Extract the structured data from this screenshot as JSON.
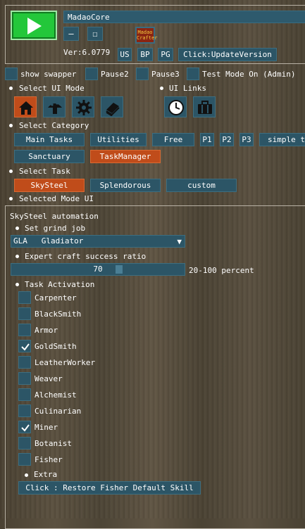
{
  "header": {
    "app_name": "MadaoCore",
    "version": "Ver:6.0779",
    "minimize_glyph": "—",
    "maximize_glyph": "☐",
    "thumbnail_text": "Madao Crafter",
    "region_buttons": [
      "US",
      "BP",
      "PG"
    ],
    "update_button": "Click:UpdateVersion"
  },
  "toggles": {
    "show_swapper": "show swapper",
    "pause2": "Pause2",
    "pause3": "Pause3",
    "test_mode": "Test Mode On (Admin)"
  },
  "ui_mode": {
    "label": "Select UI Mode",
    "icons": [
      "home-icon",
      "mushroom-icon",
      "gear-icon",
      "books-icon"
    ],
    "active_index": 0
  },
  "ui_links": {
    "label": "UI Links",
    "icons": [
      "clock-icon",
      "briefcase-icon"
    ]
  },
  "category": {
    "label": "Select Category",
    "row1": [
      "Main Tasks",
      "Utilities",
      "Free",
      "P1",
      "P2",
      "P3",
      "simple t"
    ],
    "row2": [
      "Sanctuary",
      "TaskManager"
    ],
    "active": "TaskManager"
  },
  "task": {
    "label": "Select Task",
    "options": [
      "SkySteel",
      "Splendorous",
      "custom"
    ],
    "active": "SkySteel"
  },
  "selected_mode_label": "Selected Mode UI",
  "automation": {
    "title": "SkySteel automation",
    "grind_job_label": "Set grind job",
    "grind_job_value": "GLA   Gladiator",
    "dropdown_arrow": "▼",
    "ratio_label": "Expert craft success ratio",
    "ratio_value": "70",
    "ratio_unit": "20-100 percent",
    "ratio_fraction": 0.625,
    "activation_label": "Task Activation",
    "jobs": [
      {
        "name": "Carpenter",
        "checked": false
      },
      {
        "name": "BlackSmith",
        "checked": false
      },
      {
        "name": "Armor",
        "checked": false
      },
      {
        "name": "GoldSmith",
        "checked": true
      },
      {
        "name": "LeatherWorker",
        "checked": false
      },
      {
        "name": "Weaver",
        "checked": false
      },
      {
        "name": "Alchemist",
        "checked": false
      },
      {
        "name": "Culinarian",
        "checked": false
      },
      {
        "name": "Miner",
        "checked": true
      },
      {
        "name": "Botanist",
        "checked": false
      },
      {
        "name": "Fisher",
        "checked": false
      }
    ],
    "extra_label": "Extra",
    "restore_button": "Click : Restore Fisher Default Skill"
  },
  "colors": {
    "button_bg": "#2c5566",
    "active_bg": "#c04c1a",
    "play_green": "#23c73a"
  }
}
